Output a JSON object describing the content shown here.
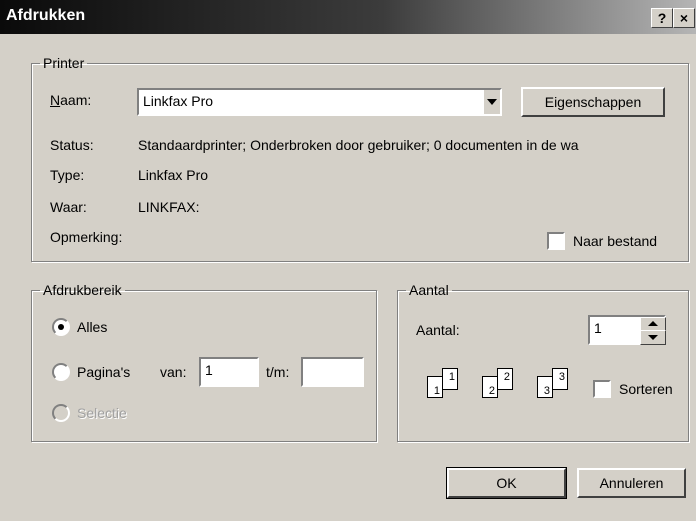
{
  "window": {
    "title": "Afdrukken",
    "help_label": "?",
    "close_label": "×"
  },
  "printer": {
    "group_label": "Printer",
    "name_label": "Naam:",
    "name_value": "Linkfax Pro",
    "properties_label": "Eigenschappen",
    "status_label": "Status:",
    "status_value": "Standaardprinter; Onderbroken door gebruiker; 0 documenten in de wa",
    "type_label": "Type:",
    "type_value": "Linkfax Pro",
    "where_label": "Waar:",
    "where_value": "LINKFAX:",
    "comment_label": "Opmerking:",
    "print_to_file_label": "Naar bestand",
    "print_to_file_checked": false
  },
  "range": {
    "group_label": "Afdrukbereik",
    "all_label": "Alles",
    "pages_label": "Pagina's",
    "from_label": "van:",
    "from_value": "1",
    "to_label": "t/m:",
    "to_value": "",
    "selection_label": "Selectie",
    "selected": "all"
  },
  "copies": {
    "group_label": "Aantal",
    "count_label": "Aantal:",
    "count_value": "1",
    "collate_label": "Sorteren",
    "collate_checked": false,
    "collate_pages": [
      "1",
      "1",
      "2",
      "2",
      "3",
      "3"
    ]
  },
  "buttons": {
    "ok_label": "OK",
    "cancel_label": "Annuleren"
  }
}
